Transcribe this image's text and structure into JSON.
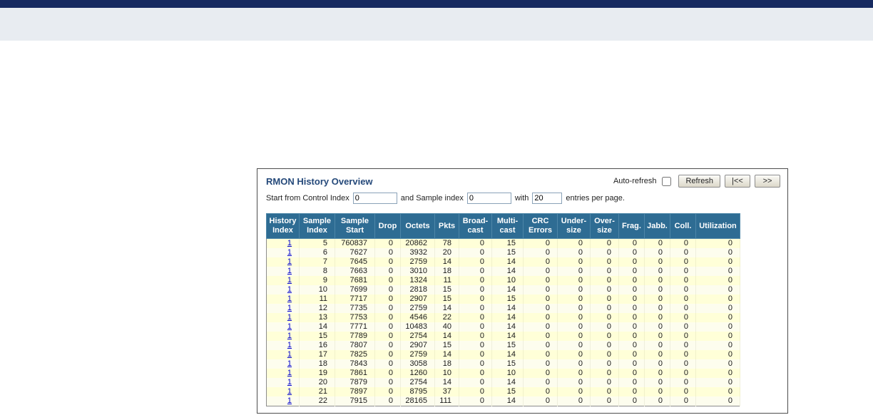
{
  "page": {
    "title": "RMON History Overview"
  },
  "toolbar": {
    "auto_refresh_label": "Auto-refresh",
    "refresh_label": "Refresh",
    "first_page_label": "|<<",
    "next_page_label": ">>"
  },
  "controls": {
    "start_text": "Start from Control Index",
    "control_index_value": "0",
    "middle_text": "and Sample index",
    "sample_index_value": "0",
    "with_text": "with",
    "entries_value": "20",
    "end_text": "entries per page."
  },
  "table": {
    "headers": [
      "History\nIndex",
      "Sample\nIndex",
      "Sample\nStart",
      "Drop",
      "Octets",
      "Pkts",
      "Broad-\ncast",
      "Multi-\ncast",
      "CRC\nErrors",
      "Under-\nsize",
      "Over-\nsize",
      "Frag.",
      "Jabb.",
      "Coll.",
      "Utilization"
    ],
    "rows": [
      [
        "1",
        "5",
        "760837",
        "0",
        "20862",
        "78",
        "0",
        "15",
        "0",
        "0",
        "0",
        "0",
        "0",
        "0",
        "0"
      ],
      [
        "1",
        "6",
        "7627",
        "0",
        "3932",
        "20",
        "0",
        "15",
        "0",
        "0",
        "0",
        "0",
        "0",
        "0",
        "0"
      ],
      [
        "1",
        "7",
        "7645",
        "0",
        "2759",
        "14",
        "0",
        "14",
        "0",
        "0",
        "0",
        "0",
        "0",
        "0",
        "0"
      ],
      [
        "1",
        "8",
        "7663",
        "0",
        "3010",
        "18",
        "0",
        "14",
        "0",
        "0",
        "0",
        "0",
        "0",
        "0",
        "0"
      ],
      [
        "1",
        "9",
        "7681",
        "0",
        "1324",
        "11",
        "0",
        "10",
        "0",
        "0",
        "0",
        "0",
        "0",
        "0",
        "0"
      ],
      [
        "1",
        "10",
        "7699",
        "0",
        "2818",
        "15",
        "0",
        "14",
        "0",
        "0",
        "0",
        "0",
        "0",
        "0",
        "0"
      ],
      [
        "1",
        "11",
        "7717",
        "0",
        "2907",
        "15",
        "0",
        "15",
        "0",
        "0",
        "0",
        "0",
        "0",
        "0",
        "0"
      ],
      [
        "1",
        "12",
        "7735",
        "0",
        "2759",
        "14",
        "0",
        "14",
        "0",
        "0",
        "0",
        "0",
        "0",
        "0",
        "0"
      ],
      [
        "1",
        "13",
        "7753",
        "0",
        "4546",
        "22",
        "0",
        "14",
        "0",
        "0",
        "0",
        "0",
        "0",
        "0",
        "0"
      ],
      [
        "1",
        "14",
        "7771",
        "0",
        "10483",
        "40",
        "0",
        "14",
        "0",
        "0",
        "0",
        "0",
        "0",
        "0",
        "0"
      ],
      [
        "1",
        "15",
        "7789",
        "0",
        "2754",
        "14",
        "0",
        "14",
        "0",
        "0",
        "0",
        "0",
        "0",
        "0",
        "0"
      ],
      [
        "1",
        "16",
        "7807",
        "0",
        "2907",
        "15",
        "0",
        "15",
        "0",
        "0",
        "0",
        "0",
        "0",
        "0",
        "0"
      ],
      [
        "1",
        "17",
        "7825",
        "0",
        "2759",
        "14",
        "0",
        "14",
        "0",
        "0",
        "0",
        "0",
        "0",
        "0",
        "0"
      ],
      [
        "1",
        "18",
        "7843",
        "0",
        "3058",
        "18",
        "0",
        "15",
        "0",
        "0",
        "0",
        "0",
        "0",
        "0",
        "0"
      ],
      [
        "1",
        "19",
        "7861",
        "0",
        "1260",
        "10",
        "0",
        "10",
        "0",
        "0",
        "0",
        "0",
        "0",
        "0",
        "0"
      ],
      [
        "1",
        "20",
        "7879",
        "0",
        "2754",
        "14",
        "0",
        "14",
        "0",
        "0",
        "0",
        "0",
        "0",
        "0",
        "0"
      ],
      [
        "1",
        "21",
        "7897",
        "0",
        "8795",
        "37",
        "0",
        "15",
        "0",
        "0",
        "0",
        "0",
        "0",
        "0",
        "0"
      ],
      [
        "1",
        "22",
        "7915",
        "0",
        "28165",
        "111",
        "0",
        "14",
        "0",
        "0",
        "0",
        "0",
        "0",
        "0",
        "0"
      ]
    ]
  },
  "colors": {
    "topbar": "#162a60",
    "banner": "#e8ecf1",
    "table_header_bg": "#2e6c93",
    "row_odd": "#ffffd8",
    "row_even": "#fdfdee",
    "title_text": "#25497a"
  }
}
